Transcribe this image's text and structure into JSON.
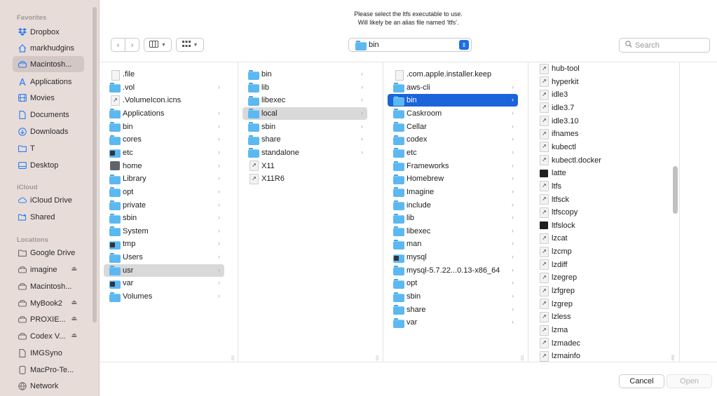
{
  "dialog": {
    "prompt_line1": "Please select the ltfs executable to use.",
    "prompt_line2": "Will likely be an alias file named 'ltfs'."
  },
  "toolbar": {
    "path_label": "bin",
    "search_placeholder": "Search",
    "view_icon": "columns-view-icon",
    "group_icon": "group-by-icon"
  },
  "sidebar": {
    "favorites_label": "Favorites",
    "favorites": [
      {
        "label": "Dropbox",
        "icon": "dropbox-icon"
      },
      {
        "label": "markhudgins",
        "icon": "home-icon"
      },
      {
        "label": "Macintosh...",
        "icon": "disk-icon"
      },
      {
        "label": "Applications",
        "icon": "applications-icon"
      },
      {
        "label": "Movies",
        "icon": "movies-icon"
      },
      {
        "label": "Documents",
        "icon": "document-icon"
      },
      {
        "label": "Downloads",
        "icon": "download-icon"
      },
      {
        "label": "T",
        "icon": "folder-icon"
      },
      {
        "label": "Desktop",
        "icon": "desktop-icon"
      }
    ],
    "icloud_label": "iCloud",
    "icloud": [
      {
        "label": "iCloud Drive",
        "icon": "cloud-icon"
      },
      {
        "label": "Shared",
        "icon": "shared-folder-icon"
      }
    ],
    "locations_label": "Locations",
    "locations": [
      {
        "label": "Google Drive",
        "icon": "folder-icon"
      },
      {
        "label": "imagine",
        "icon": "disk-icon"
      },
      {
        "label": "Macintosh...",
        "icon": "disk-icon"
      },
      {
        "label": "MyBook2",
        "icon": "disk-icon"
      },
      {
        "label": "PROXIE...",
        "icon": "disk-icon"
      },
      {
        "label": "Codex V...",
        "icon": "disk-icon"
      },
      {
        "label": "IMGSyno",
        "icon": "document-icon"
      },
      {
        "label": "MacPro-Te...",
        "icon": "display-icon"
      },
      {
        "label": "Network",
        "icon": "network-icon"
      }
    ]
  },
  "columns": [
    {
      "items": [
        {
          "label": ".file",
          "type": "doc"
        },
        {
          "label": ".vol",
          "type": "folder"
        },
        {
          "label": ".VolumeIcon.icns",
          "type": "alias"
        },
        {
          "label": "Applications",
          "type": "folder"
        },
        {
          "label": "bin",
          "type": "folder"
        },
        {
          "label": "cores",
          "type": "folder"
        },
        {
          "label": "etc",
          "type": "sbadge"
        },
        {
          "label": "home",
          "type": "system"
        },
        {
          "label": "Library",
          "type": "folder"
        },
        {
          "label": "opt",
          "type": "folder"
        },
        {
          "label": "private",
          "type": "folder"
        },
        {
          "label": "sbin",
          "type": "folder"
        },
        {
          "label": "System",
          "type": "folder"
        },
        {
          "label": "tmp",
          "type": "sbadge"
        },
        {
          "label": "Users",
          "type": "folder"
        },
        {
          "label": "usr",
          "type": "folder"
        },
        {
          "label": "var",
          "type": "sbadge"
        },
        {
          "label": "Volumes",
          "type": "folder"
        }
      ]
    },
    {
      "items": [
        {
          "label": "bin",
          "type": "folder"
        },
        {
          "label": "lib",
          "type": "folder"
        },
        {
          "label": "libexec",
          "type": "folder"
        },
        {
          "label": "local",
          "type": "folder"
        },
        {
          "label": "sbin",
          "type": "folder"
        },
        {
          "label": "share",
          "type": "folder"
        },
        {
          "label": "standalone",
          "type": "folder"
        },
        {
          "label": "X11",
          "type": "alias"
        },
        {
          "label": "X11R6",
          "type": "alias"
        }
      ]
    },
    {
      "items": [
        {
          "label": ".com.apple.installer.keep",
          "type": "doc"
        },
        {
          "label": "aws-cli",
          "type": "folder"
        },
        {
          "label": "bin",
          "type": "folder"
        },
        {
          "label": "Caskroom",
          "type": "folder"
        },
        {
          "label": "Cellar",
          "type": "folder"
        },
        {
          "label": "codex",
          "type": "folder"
        },
        {
          "label": "etc",
          "type": "folder"
        },
        {
          "label": "Frameworks",
          "type": "folder"
        },
        {
          "label": "Homebrew",
          "type": "folder"
        },
        {
          "label": "Imagine",
          "type": "folder"
        },
        {
          "label": "include",
          "type": "folder"
        },
        {
          "label": "lib",
          "type": "folder"
        },
        {
          "label": "libexec",
          "type": "folder"
        },
        {
          "label": "man",
          "type": "folder"
        },
        {
          "label": "mysql",
          "type": "sbadge"
        },
        {
          "label": "mysql-5.7.22...0.13-x86_64",
          "type": "folder"
        },
        {
          "label": "opt",
          "type": "folder"
        },
        {
          "label": "sbin",
          "type": "folder"
        },
        {
          "label": "share",
          "type": "folder"
        },
        {
          "label": "var",
          "type": "folder"
        }
      ]
    },
    {
      "items": [
        {
          "label": "hub-tool",
          "type": "alias"
        },
        {
          "label": "hyperkit",
          "type": "alias"
        },
        {
          "label": "idle3",
          "type": "alias"
        },
        {
          "label": "idle3.7",
          "type": "alias"
        },
        {
          "label": "idle3.10",
          "type": "alias"
        },
        {
          "label": "ifnames",
          "type": "alias"
        },
        {
          "label": "kubectl",
          "type": "alias"
        },
        {
          "label": "kubectl.docker",
          "type": "alias"
        },
        {
          "label": "latte",
          "type": "exec"
        },
        {
          "label": "ltfs",
          "type": "alias"
        },
        {
          "label": "ltfsck",
          "type": "alias"
        },
        {
          "label": "ltfscopy",
          "type": "alias"
        },
        {
          "label": "ltfslock",
          "type": "exec"
        },
        {
          "label": "lzcat",
          "type": "alias"
        },
        {
          "label": "lzcmp",
          "type": "alias"
        },
        {
          "label": "lzdiff",
          "type": "alias"
        },
        {
          "label": "lzegrep",
          "type": "alias"
        },
        {
          "label": "lzfgrep",
          "type": "alias"
        },
        {
          "label": "lzgrep",
          "type": "alias"
        },
        {
          "label": "lzless",
          "type": "alias"
        },
        {
          "label": "lzma",
          "type": "alias"
        },
        {
          "label": "lzmadec",
          "type": "alias"
        },
        {
          "label": "lzmainfo",
          "type": "alias"
        }
      ]
    }
  ],
  "footer": {
    "cancel_label": "Cancel",
    "open_label": "Open"
  }
}
